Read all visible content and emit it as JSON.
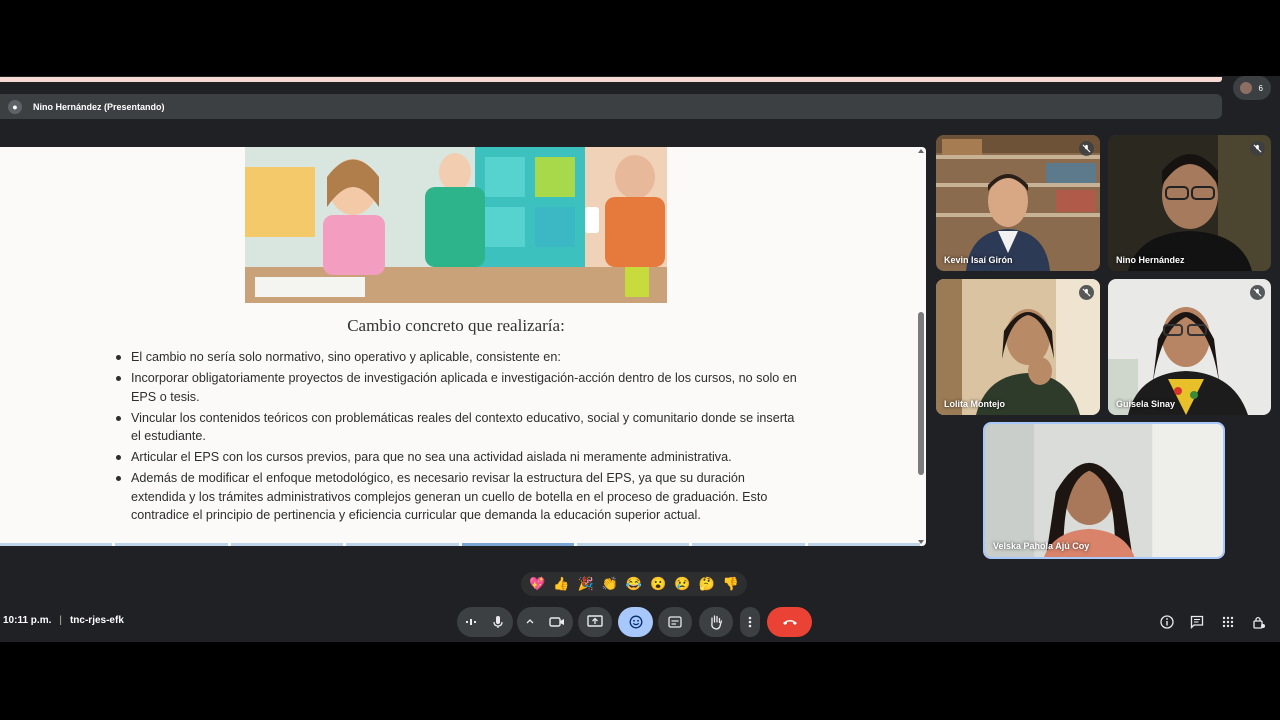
{
  "presenter": {
    "name": "Nino Hernández (Presentando)"
  },
  "participants_count": "6",
  "slide": {
    "title": "Cambio concreto que realizaría:",
    "bullets": [
      "El cambio no sería solo normativo, sino operativo y aplicable, consistente en:",
      "Incorporar obligatoriamente proyectos de investigación aplicada e investigación-acción dentro de los cursos, no solo en EPS o tesis.",
      "Vincular los contenidos teóricos con problemáticas reales del contexto educativo, social y comunitario donde se inserta el estudiante.",
      "Articular el EPS con los cursos previos, para que no sea una actividad aislada ni meramente administrativa.",
      "Además de modificar el enfoque metodológico, es necesario revisar la estructura del EPS, ya que su duración extendida y los trámites administrativos complejos generan un cuello de botella en el proceso de graduación. Esto contradice el principio de pertinencia y eficiencia curricular que demanda la educación superior actual."
    ]
  },
  "tiles": [
    {
      "name": "Kevin Isaí Girón",
      "muted": true
    },
    {
      "name": "Nino Hernández",
      "muted": true
    },
    {
      "name": "Lolita Montejo",
      "muted": true
    },
    {
      "name": "Guisela Sinay",
      "muted": true
    },
    {
      "name": "Velska Pahola Ajú Coy",
      "muted": false
    }
  ],
  "reactions": [
    "💖",
    "👍",
    "🎉",
    "👏",
    "😂",
    "😮",
    "😢",
    "🤔",
    "👎"
  ],
  "meeting": {
    "time": "10:11 p.m.",
    "separator": "|",
    "code": "tnc-rjes-efk"
  },
  "colors": {
    "end_call": "#ea4335",
    "active_control": "#a8c7fa",
    "background": "#202124"
  }
}
